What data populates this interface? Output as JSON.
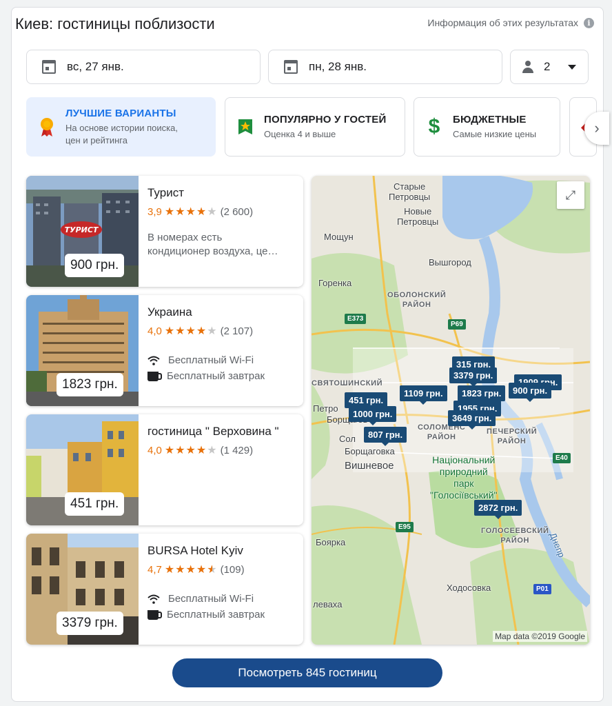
{
  "header": {
    "title": "Киев: гостиницы поблизости",
    "about": "Информация об этих результатах"
  },
  "dates": {
    "checkin": "вс, 27 янв.",
    "checkout": "пн, 28 янв."
  },
  "guests": {
    "count": "2"
  },
  "filters": [
    {
      "title": "ЛУЧШИЕ ВАРИАНТЫ",
      "sub1": "На основе истории поиска,",
      "sub2": "цен и рейтинга"
    },
    {
      "title": "ПОПУЛЯРНО У ГОСТЕЙ",
      "sub1": "Оценка 4 и выше"
    },
    {
      "title": "БЮДЖЕТНЫЕ",
      "sub1": "Самые низкие цены"
    }
  ],
  "hotels": [
    {
      "name": "Турист",
      "rating": "3,9",
      "stars": 3.9,
      "reviews": "(2 600)",
      "price": "900 грн.",
      "desc1": "В номерах есть",
      "desc2": "кондиционер воздуха, це…"
    },
    {
      "name": "Украина",
      "rating": "4,0",
      "stars": 4.0,
      "reviews": "(2 107)",
      "price": "1823 грн.",
      "amenity1": "Бесплатный Wi-Fi",
      "amenity2": "Бесплатный завтрак"
    },
    {
      "name": "гостиница \" Верховина \"",
      "rating": "4,0",
      "stars": 4.0,
      "reviews": "(1 429)",
      "price": "451 грн."
    },
    {
      "name": "BURSA Hotel Kyiv",
      "rating": "4,7",
      "stars": 4.7,
      "reviews": "(109)",
      "price": "3379 грн.",
      "amenity1": "Бесплатный Wi-Fi",
      "amenity2": "Бесплатный завтрак"
    }
  ],
  "map": {
    "labels": {
      "starye": "Старые",
      "starye2": "Петровцы",
      "novye": "Новые",
      "novye2": "Петровцы",
      "moshchun": "Мощун",
      "vyshgorod": "Вышгород",
      "gorenka": "Горенка",
      "obolon1": "ОБОЛОНСКИЙ",
      "obolon2": "РАЙОН",
      "svyatosh": "СВЯТОШИНСКИЙ",
      "petro": "Петро",
      "borsh": "Борщагов",
      "sol": "Сол",
      "solomen1": "СОЛОМЕНС",
      "solomen2": "РАЙОН",
      "pechersk1": "ПЕЧЕРСКИЙ",
      "pechersk2": "РАЙОН",
      "borshch2": "Борщаговка",
      "vyshnevoe": "Вишневое",
      "park1": "Національний",
      "park2": "природний",
      "park3": "парк",
      "park4": "\"Голосіївський\"",
      "golos1": "ГОЛОСЕЕВСКИЙ",
      "golos2": "РАЙОН",
      "boyarka": "Боярка",
      "dnepr": "Днепр",
      "khodos": "Ходосовка",
      "levakha": "левахa"
    },
    "roads": {
      "e373": "E373",
      "p69": "P69",
      "e40": "E40",
      "e95": "E95",
      "p01": "P01"
    },
    "pins": [
      "315 грн.",
      "3379 грн.",
      "1909 грн.",
      "1109 грн.",
      "1823 грн.",
      "900 грн.",
      "451 грн.",
      "1955 грн.",
      "1000 грн.",
      "3649 грн.",
      "807 грн.",
      "2872 грн."
    ],
    "attribution": "Map data ©2019 Google"
  },
  "cta": {
    "label": "Посмотреть 845 гостиниц"
  },
  "colors": {
    "accent": "#1a73e8",
    "pin": "#1a4b75",
    "star": "#e8710a",
    "cta": "#1a4b8c"
  }
}
